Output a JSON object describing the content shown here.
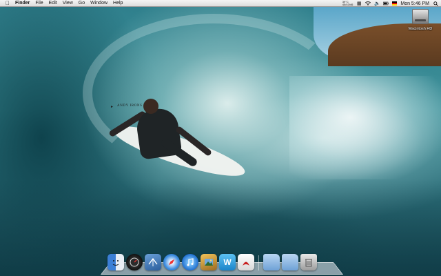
{
  "menubar": {
    "apple_icon": "apple-icon",
    "app_name": "Finder",
    "menus": [
      "File",
      "Edit",
      "View",
      "Go",
      "Window",
      "Help"
    ],
    "weather": {
      "temp": "39°C",
      "detail": "45/43/46"
    },
    "status_icons": [
      "grid-icon",
      "wifi-icon",
      "volume-icon",
      "battery-icon"
    ],
    "clock": "Mon 5:46 PM",
    "search_icon": "spotlight-icon"
  },
  "desktop": {
    "drive_label": "Macintosh HD"
  },
  "wallpaper": {
    "caption": "ANDY IRONS"
  },
  "dock": {
    "items": [
      {
        "name": "Finder",
        "icon": "finder-icon"
      },
      {
        "name": "Dashboard",
        "icon": "dashboard-icon"
      },
      {
        "name": "Mail",
        "icon": "mail-icon"
      },
      {
        "name": "Safari",
        "icon": "safari-icon"
      },
      {
        "name": "iTunes",
        "icon": "itunes-icon"
      },
      {
        "name": "iPhoto",
        "icon": "iphoto-icon"
      },
      {
        "name": "Wunderlist",
        "icon": "wunderlist-icon",
        "glyph": "W"
      },
      {
        "name": "Adobe Reader",
        "icon": "pdf-icon"
      },
      {
        "name": "Applications",
        "icon": "folder-icon"
      },
      {
        "name": "Downloads",
        "icon": "folder-icon"
      },
      {
        "name": "Trash",
        "icon": "trash-icon"
      }
    ]
  },
  "colors": {
    "menubar_bg": "#e6e6e6",
    "water_dark": "#184a55",
    "water_light": "#3c8f98"
  }
}
